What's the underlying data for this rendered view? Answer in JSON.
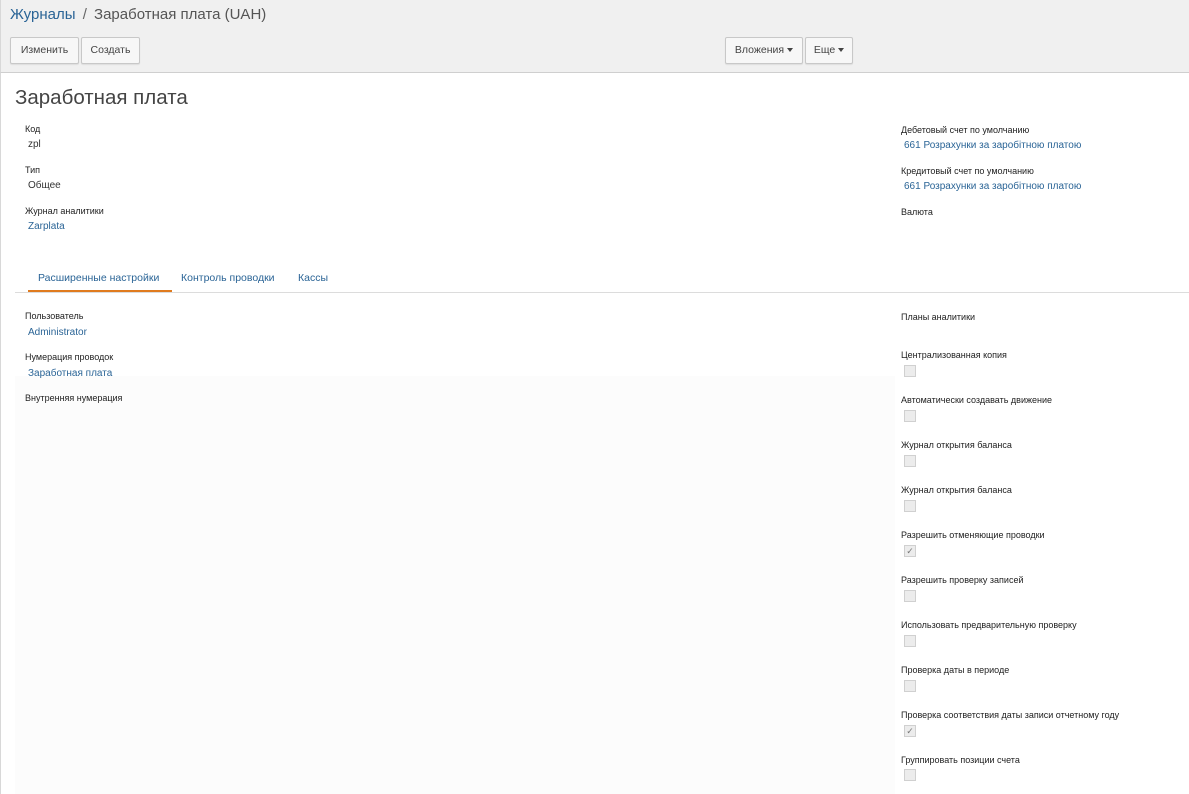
{
  "breadcrumb": {
    "root": "Журналы",
    "separator": "/",
    "current": "Заработная плата (UAH)"
  },
  "toolbar": {
    "edit_label": "Изменить",
    "create_label": "Создать",
    "attachments_label": "Вложения",
    "more_label": "Еще"
  },
  "record": {
    "title": "Заработная плата",
    "left_fields": {
      "code_label": "Код",
      "code_value": "zpl",
      "type_label": "Тип",
      "type_value": "Общее",
      "analytic_label": "Журнал аналитики",
      "analytic_value": "Zarplata"
    },
    "right_fields": {
      "debit_label": "Дебетовый счет по умолчанию",
      "debit_value": "661 Розрахунки за заробітною платою",
      "credit_label": "Кредитовый счет по умолчанию",
      "credit_value": "661 Розрахунки за заробітною платою",
      "currency_label": "Валюта"
    }
  },
  "tabs": [
    {
      "label": "Расширенные настройки",
      "active": true
    },
    {
      "label": "Контроль проводки",
      "active": false
    },
    {
      "label": "Кассы",
      "active": false
    }
  ],
  "advanced": {
    "user_label": "Пользователь",
    "user_value": "Administrator",
    "sequence_label": "Нумерация проводок",
    "sequence_value": "Заработная плата",
    "internal_seq_label": "Внутренняя нумерация",
    "analytic_plans_label": "Планы аналитики",
    "checkboxes": [
      {
        "label": "Централизованная копия",
        "checked": false
      },
      {
        "label": "Автоматически создавать движение",
        "checked": false
      },
      {
        "label": "Журнал открытия баланса",
        "checked": false
      },
      {
        "label": "Журнал открытия баланса",
        "checked": false
      },
      {
        "label": "Разрешить отменяющие проводки",
        "checked": true
      },
      {
        "label": "Разрешить проверку записей",
        "checked": false
      },
      {
        "label": "Использовать предварительную проверку",
        "checked": false
      },
      {
        "label": "Проверка даты в периоде",
        "checked": false
      },
      {
        "label": "Проверка соответствия даты записи отчетному году",
        "checked": true
      },
      {
        "label": "Группировать позиции счета",
        "checked": false
      }
    ]
  },
  "colors": {
    "link": "#2a6496",
    "tab_active": "#e07b1f",
    "topbar_bg": "#f0f0f0"
  },
  "icons": {
    "checkmark": "✓"
  }
}
